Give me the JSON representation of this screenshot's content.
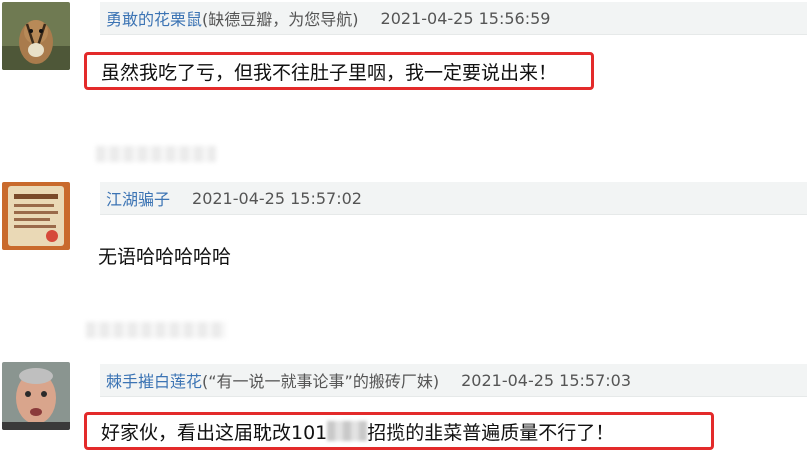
{
  "comments": [
    {
      "username": "勇敢的花栗鼠",
      "note": " (缺德豆瓣，为您导航)",
      "timestamp": "2021-04-25 15:56:59",
      "text": "虽然我吃了亏，但我不往肚子里咽，我一定要说出来！",
      "highlighted": true
    },
    {
      "username": "江湖骗子",
      "note": "",
      "timestamp": "2021-04-25 15:57:02",
      "text": "无语哈哈哈哈哈",
      "highlighted": false
    },
    {
      "username": "棘手摧白莲花",
      "note": " (“有一说一就事论事”的搬砖厂妹)",
      "timestamp": "2021-04-25 15:57:03",
      "text_before": "好家伙，看出这届耽改101",
      "text_after": "招揽的韭菜普遍质量不行了！",
      "highlighted": true
    }
  ],
  "colors": {
    "username": "#3c74b4",
    "meta_background": "#f2f4f4",
    "highlight_border": "#e32a2a"
  }
}
